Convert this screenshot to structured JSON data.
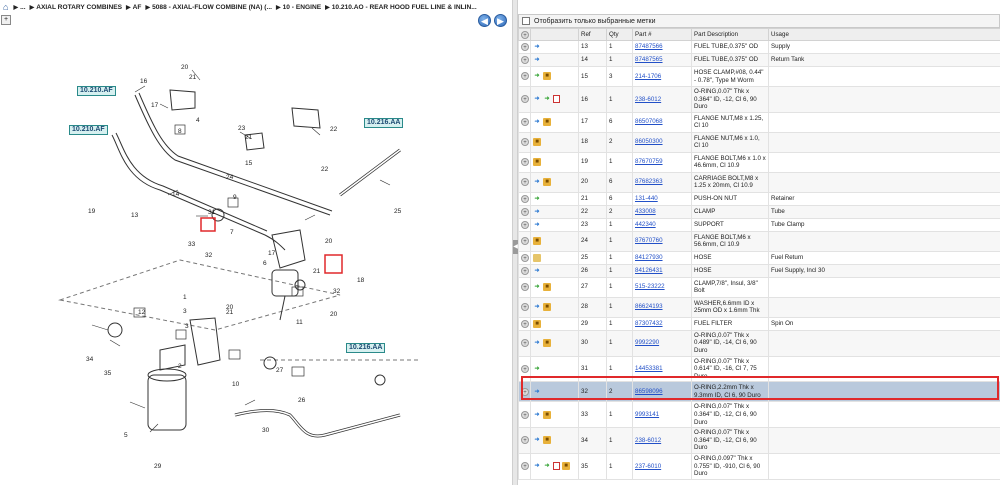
{
  "breadcrumb": {
    "home_icon": "home-icon",
    "items": [
      "...",
      "AXIAL ROTARY COMBINES",
      "AF",
      "5088 - AXIAL-FLOW COMBINE (NA) (...",
      "10 - ENGINE",
      "10.210.AO - REAR HOOD FUEL LINE & INLIN..."
    ]
  },
  "nav": {
    "back": "◀",
    "forward": "▶"
  },
  "diagram": {
    "callouts": [
      "10.210.AF",
      "10.210.AF",
      "10.216.AA",
      "10.216.AA"
    ],
    "refs": [
      "16",
      "20",
      "21",
      "17",
      "4",
      "3",
      "22",
      "8",
      "23",
      "21",
      "24",
      "9",
      "19",
      "13",
      "14",
      "22",
      "25",
      "7",
      "33",
      "32",
      "20",
      "17",
      "6",
      "21",
      "32",
      "11",
      "1",
      "3",
      "21",
      "20",
      "12",
      "34",
      "2",
      "35",
      "10",
      "27",
      "26",
      "5",
      "30",
      "29",
      "18",
      "15",
      "31",
      "20"
    ]
  },
  "filter": {
    "label": "Отобразить только выбранные метки"
  },
  "table": {
    "headers": [
      "",
      "",
      "Ref",
      "Qty",
      "Part #",
      "Part Description",
      "Usage"
    ],
    "rows": [
      {
        "icons": [
          "swap"
        ],
        "ref": "13",
        "qty": "1",
        "part": "87487566",
        "desc": "FUEL TUBE,0.375\" OD",
        "usage": "Supply"
      },
      {
        "icons": [
          "swap"
        ],
        "ref": "14",
        "qty": "1",
        "part": "87487565",
        "desc": "FUEL TUBE,0.375\" OD",
        "usage": "Return Tank"
      },
      {
        "icons": [
          "green",
          "box"
        ],
        "ref": "15",
        "qty": "3",
        "part": "214-1706",
        "desc": "HOSE CLAMP,#08, 0.44\" - 0.78\", Type M Worm",
        "usage": ""
      },
      {
        "icons": [
          "swap",
          "green",
          "doc"
        ],
        "ref": "16",
        "qty": "1",
        "part": "238-6012",
        "desc": "O-RING,0.07\" Thk x 0.364\" ID, -12, Cl 6, 90 Duro",
        "usage": ""
      },
      {
        "icons": [
          "swap",
          "box"
        ],
        "ref": "17",
        "qty": "6",
        "part": "86507068",
        "desc": "FLANGE NUT,M8 x 1.25, Cl 10",
        "usage": ""
      },
      {
        "icons": [
          "box"
        ],
        "ref": "18",
        "qty": "2",
        "part": "86050300",
        "desc": "FLANGE NUT,M6 x 1.0, Cl 10",
        "usage": ""
      },
      {
        "icons": [
          "box"
        ],
        "ref": "19",
        "qty": "1",
        "part": "87670759",
        "desc": "FLANGE BOLT,M6 x 1.0 x 46.6mm, Cl 10.9",
        "usage": ""
      },
      {
        "icons": [
          "swap",
          "box"
        ],
        "ref": "20",
        "qty": "6",
        "part": "87682363",
        "desc": "CARRIAGE BOLT,M8 x 1.25 x 20mm, Cl 10.9",
        "usage": ""
      },
      {
        "icons": [
          "green"
        ],
        "ref": "21",
        "qty": "6",
        "part": "131-440",
        "desc": "PUSH-ON NUT",
        "usage": "Retainer"
      },
      {
        "icons": [
          "swap"
        ],
        "ref": "22",
        "qty": "2",
        "part": "433008",
        "desc": "CLAMP",
        "usage": "Tube"
      },
      {
        "icons": [
          "swap"
        ],
        "ref": "23",
        "qty": "1",
        "part": "442340",
        "desc": "SUPPORT",
        "usage": "Tube Clamp"
      },
      {
        "icons": [
          "box"
        ],
        "ref": "24",
        "qty": "1",
        "part": "87670760",
        "desc": "FLANGE BOLT,M6 x 56.6mm, Cl 10.9",
        "usage": ""
      },
      {
        "icons": [
          "tag"
        ],
        "ref": "25",
        "qty": "1",
        "part": "84127930",
        "desc": "HOSE",
        "usage": "Fuel Return"
      },
      {
        "icons": [
          "swap"
        ],
        "ref": "26",
        "qty": "1",
        "part": "84126431",
        "desc": "HOSE",
        "usage": "Fuel Supply, Incl 30"
      },
      {
        "icons": [
          "green",
          "box"
        ],
        "ref": "27",
        "qty": "1",
        "part": "515-23222",
        "desc": "CLAMP,7/8\", Insul, 3/8\" Bolt",
        "usage": ""
      },
      {
        "icons": [
          "swap",
          "box"
        ],
        "ref": "28",
        "qty": "1",
        "part": "86624193",
        "desc": "WASHER,6.6mm ID x 25mm OD x 1.6mm Thk",
        "usage": ""
      },
      {
        "icons": [
          "box"
        ],
        "ref": "29",
        "qty": "1",
        "part": "87307432",
        "desc": "FUEL FILTER",
        "usage": "Spin On"
      },
      {
        "icons": [
          "swap",
          "box"
        ],
        "ref": "30",
        "qty": "1",
        "part": "9992290",
        "desc": "O-RING,0.07\" Thk x 0.489\" ID, -14, Cl 6, 90 Duro",
        "usage": ""
      },
      {
        "icons": [
          "green"
        ],
        "ref": "31",
        "qty": "1",
        "part": "14453381",
        "desc": "O-RING,0.07\" Thk x 0.614\" ID, -16, Cl 7, 75 Duro",
        "usage": ""
      },
      {
        "icons": [
          "swap"
        ],
        "ref": "32",
        "qty": "2",
        "part": "86598096",
        "desc": "O-RING,2.2mm Thk x 9.3mm ID, Cl 6, 90 Duro",
        "usage": "",
        "selected": true
      },
      {
        "icons": [
          "swap",
          "box"
        ],
        "ref": "33",
        "qty": "1",
        "part": "9993141",
        "desc": "O-RING,0.07\" Thk x 0.364\" ID, -12, Cl 6, 90 Duro",
        "usage": ""
      },
      {
        "icons": [
          "swap",
          "box"
        ],
        "ref": "34",
        "qty": "1",
        "part": "238-6012",
        "desc": "O-RING,0.07\" Thk x 0.364\" ID, -12, Cl 6, 90 Duro",
        "usage": ""
      },
      {
        "icons": [
          "swap",
          "green",
          "doc",
          "box"
        ],
        "ref": "35",
        "qty": "1",
        "part": "237-6010",
        "desc": "O-RING,0.097\" Thk x 0.755\" ID, -910, Cl 6, 90 Duro",
        "usage": ""
      }
    ]
  }
}
